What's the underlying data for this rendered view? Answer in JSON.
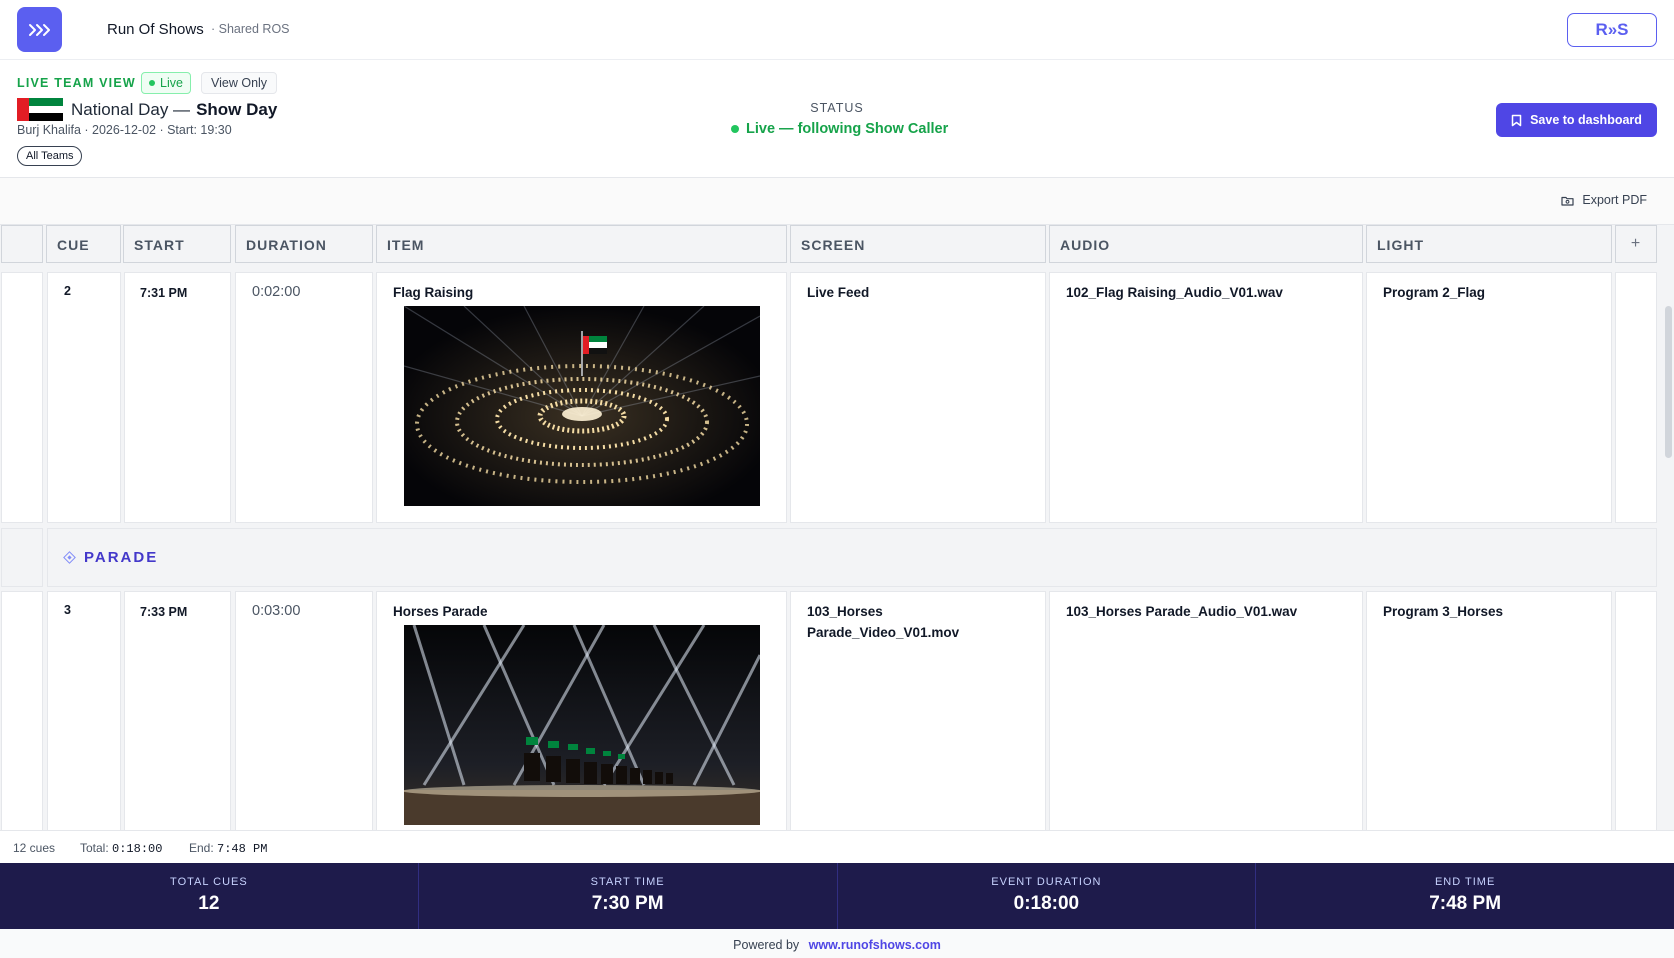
{
  "app": {
    "name": "Run Of Shows",
    "subtitle": "· Shared ROS",
    "brand_mark": "R»S"
  },
  "event": {
    "view_label": "LIVE TEAM VIEW",
    "live_badge": "Live",
    "view_only_badge": "View Only",
    "title_prefix": "National Day —",
    "title_main": "Show Day",
    "meta": "Burj Khalifa · 2026-12-02 · Start: 19:30",
    "teams_filter": "All Teams",
    "flag_colors": {
      "red": "#e21d24",
      "green": "#00843d",
      "white": "#ffffff",
      "black": "#000000"
    }
  },
  "status": {
    "label": "STATUS",
    "value": "Live — following Show Caller",
    "color": "#16a34a"
  },
  "actions": {
    "save": "Save to dashboard",
    "export": "Export PDF"
  },
  "columns": [
    "CUE",
    "START",
    "DURATION",
    "ITEM",
    "SCREEN",
    "AUDIO",
    "LIGHT"
  ],
  "add_column": "+",
  "rows": [
    {
      "cue": "2",
      "start": "7:31 PM",
      "duration": "0:02:00",
      "item": "Flag Raising",
      "item_image": "fountain-flag-image",
      "screen": "Live Feed",
      "audio": "102_Flag Raising_Audio_V01.wav",
      "light": "Program 2_Flag"
    },
    {
      "cue": "3",
      "start": "7:33 PM",
      "duration": "0:03:00",
      "item": "Horses Parade",
      "item_image": "horses-parade-image",
      "screen": "103_Horses Parade_Video_V01.mov",
      "audio": "103_Horses Parade_Audio_V01.wav",
      "light": "Program 3_Horses"
    }
  ],
  "section": {
    "name": "PARADE",
    "icon": "diamond-icon"
  },
  "summary": {
    "cues": "12 cues",
    "total_label": "Total:",
    "total": "0:18:00",
    "end_label": "End:",
    "end": "7:48 PM"
  },
  "stats": [
    {
      "label": "TOTAL CUES",
      "value": "12"
    },
    {
      "label": "START TIME",
      "value": "7:30 PM"
    },
    {
      "label": "EVENT DURATION",
      "value": "0:18:00"
    },
    {
      "label": "END TIME",
      "value": "7:48 PM"
    }
  ],
  "footer": {
    "powered": "Powered by",
    "link": "www.runofshows.com"
  },
  "colors": {
    "accent": "#4f46e5",
    "live": "#16a34a",
    "stats_bg": "#1e1b4b"
  }
}
